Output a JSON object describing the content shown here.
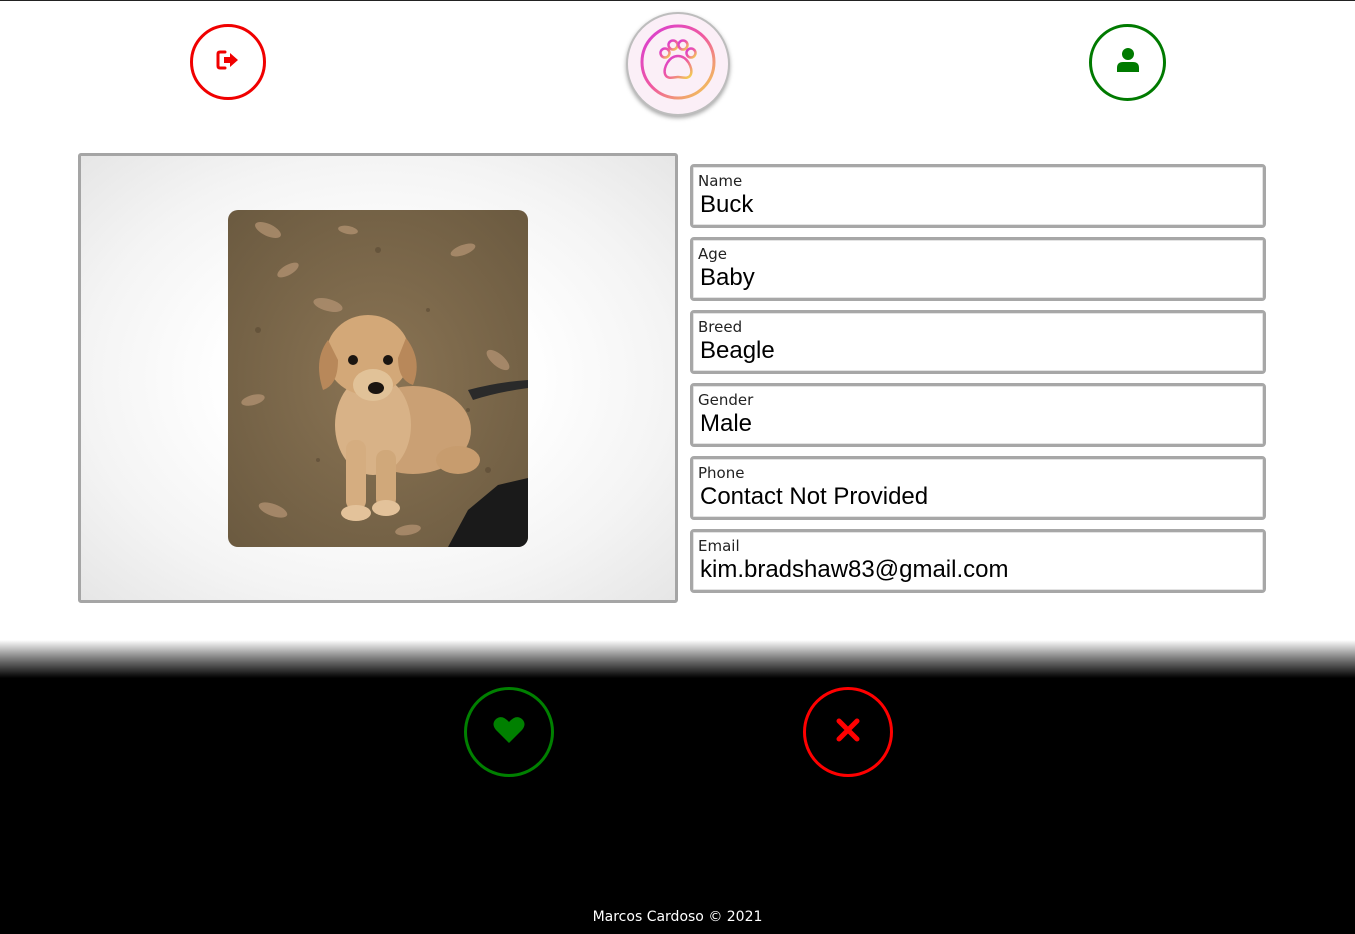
{
  "header": {
    "logout_icon": "sign-out-icon",
    "logo_icon": "paw-icon",
    "profile_icon": "user-icon",
    "colors": {
      "logout": "#f00000",
      "profile": "#007a00",
      "logo_gradient": [
        "#e040c0",
        "#f0d050"
      ]
    }
  },
  "pet": {
    "photo_alt": "puppy",
    "fields": [
      {
        "label": "Name",
        "value": "Buck"
      },
      {
        "label": "Age",
        "value": "Baby"
      },
      {
        "label": "Breed",
        "value": "Beagle"
      },
      {
        "label": "Gender",
        "value": "Male"
      },
      {
        "label": "Phone",
        "value": "Contact Not Provided"
      },
      {
        "label": "Email",
        "value": "kim.bradshaw83@gmail.com"
      }
    ]
  },
  "actions": {
    "like_icon": "heart-icon",
    "pass_icon": "close-icon",
    "colors": {
      "like": "#008000",
      "pass": "#ff0000"
    }
  },
  "footer": {
    "copyright": "Marcos Cardoso © 2021"
  }
}
